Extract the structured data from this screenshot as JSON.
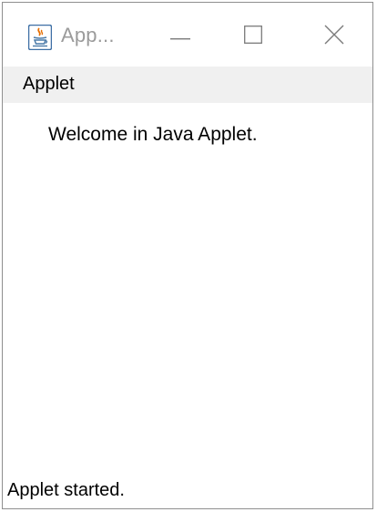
{
  "window": {
    "title": "App...",
    "controls": {
      "minimize": "minimize",
      "maximize": "maximize",
      "close": "close"
    }
  },
  "menubar": {
    "label": "Applet"
  },
  "applet": {
    "message": "Welcome in Java Applet."
  },
  "status": {
    "text": "Applet started."
  },
  "icons": {
    "app": "java-cup-icon",
    "minimize": "minimize-icon",
    "maximize": "maximize-icon",
    "close": "close-icon"
  },
  "colors": {
    "title_text": "#9b9b9b",
    "menubar_bg": "#f0f0f0",
    "window_border": "#8f8f8f",
    "icon_orange": "#e76f00",
    "icon_blue": "#4a7aa8"
  }
}
